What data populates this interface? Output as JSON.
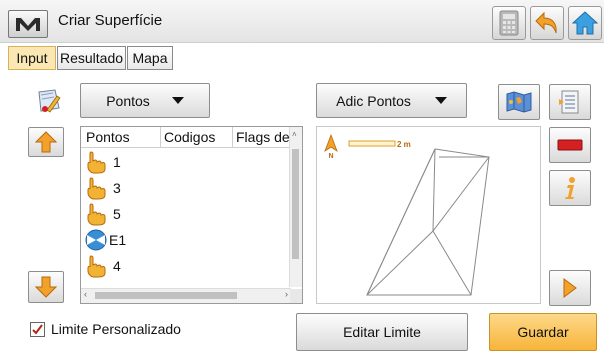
{
  "window": {
    "title": "Criar Superfície"
  },
  "tabs": [
    {
      "label": "Input",
      "active": true
    },
    {
      "label": "Resultado",
      "active": false
    },
    {
      "label": "Mapa",
      "active": false
    }
  ],
  "controls": {
    "source_dropdown": "Pontos",
    "add_points_dropdown": "Adic Pontos"
  },
  "list": {
    "columns": [
      "Pontos",
      "Codigos",
      "Flags de"
    ],
    "rows": [
      {
        "name": "1",
        "icon": "hand-point-icon"
      },
      {
        "name": "3",
        "icon": "hand-point-icon"
      },
      {
        "name": "5",
        "icon": "hand-point-icon"
      },
      {
        "name": "E1",
        "icon": "station-icon"
      },
      {
        "name": "4",
        "icon": "hand-point-icon"
      }
    ]
  },
  "map": {
    "north_label": "N",
    "scale_label": "2 m"
  },
  "footer": {
    "checkbox_label": "Limite Personalizado",
    "checkbox_checked": true,
    "edit_button": "Editar Limite",
    "save_button": "Guardar"
  },
  "colors": {
    "accent": "#f2a12a",
    "save_button": "#fbc85e",
    "active_tab": "#fbe7b3",
    "delete_red": "#d42020",
    "home_blue": "#3aa0e0"
  }
}
